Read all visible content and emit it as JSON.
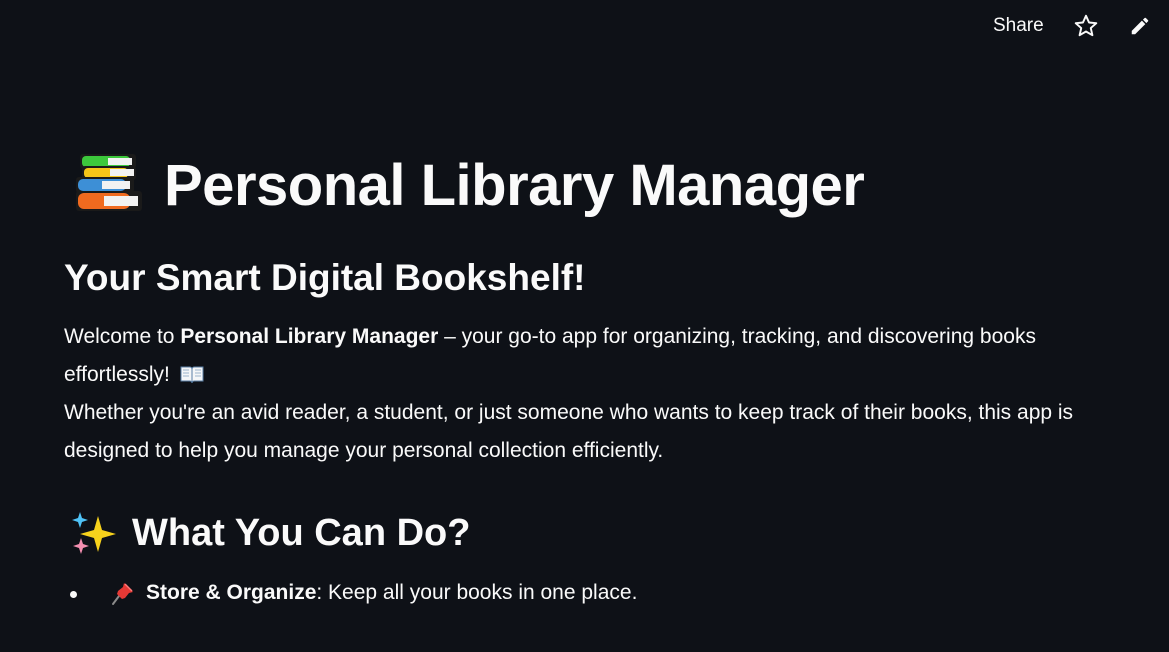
{
  "topbar": {
    "share_label": "Share",
    "star_icon": "star-icon",
    "edit_icon": "pencil-icon"
  },
  "header": {
    "title_icon": "books-icon",
    "title": "Personal Library Manager",
    "subtitle": "Your Smart Digital Bookshelf!"
  },
  "intro": {
    "welcome_prefix": "Welcome to ",
    "app_name": "Personal Library Manager",
    "welcome_suffix": " – your go-to app for organizing, tracking, and discovering books effortlessly!",
    "book_icon": "open-book-icon",
    "description": "Whether you're an avid reader, a student, or just someone who wants to keep track of their books, this app is designed to help you manage your personal collection efficiently."
  },
  "features_section": {
    "icon": "sparkles-icon",
    "title": "What You Can Do?",
    "items": [
      {
        "icon": "pushpin-icon",
        "name": "Store & Organize",
        "description": ": Keep all your books in one place."
      }
    ]
  },
  "colors": {
    "background": "#0e1117",
    "text": "#fafafa"
  }
}
